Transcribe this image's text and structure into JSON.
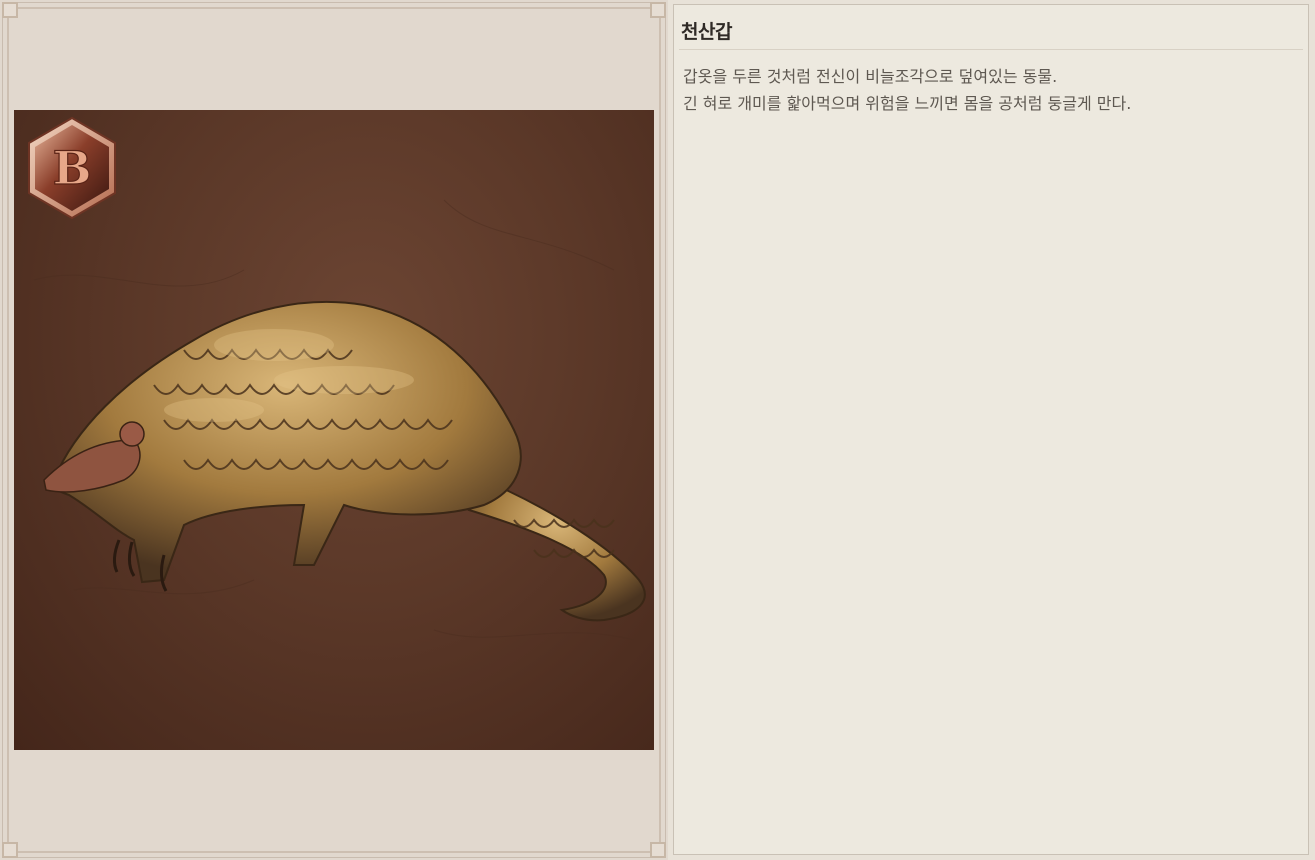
{
  "creature": {
    "name": "천산갑",
    "grade": "B",
    "description_lines": [
      "갑옷을 두른 것처럼 전신이 비늘조각으로 덮여있는 동물.",
      "긴 혀로 개미를 핥아먹으며 위험을 느끼면 몸을 공처럼 둥글게 만다."
    ]
  },
  "colors": {
    "art_background": "#5b3828",
    "panel_background": "#ede9df",
    "frame_background": "#e1d8ce",
    "badge_accent": "#c78367",
    "title_text": "#2f2a26",
    "body_text": "#5e5851"
  },
  "icons": {
    "grade_badge": "hexagon-grade-badge-icon",
    "creature_art": "pangolin-illustration"
  }
}
